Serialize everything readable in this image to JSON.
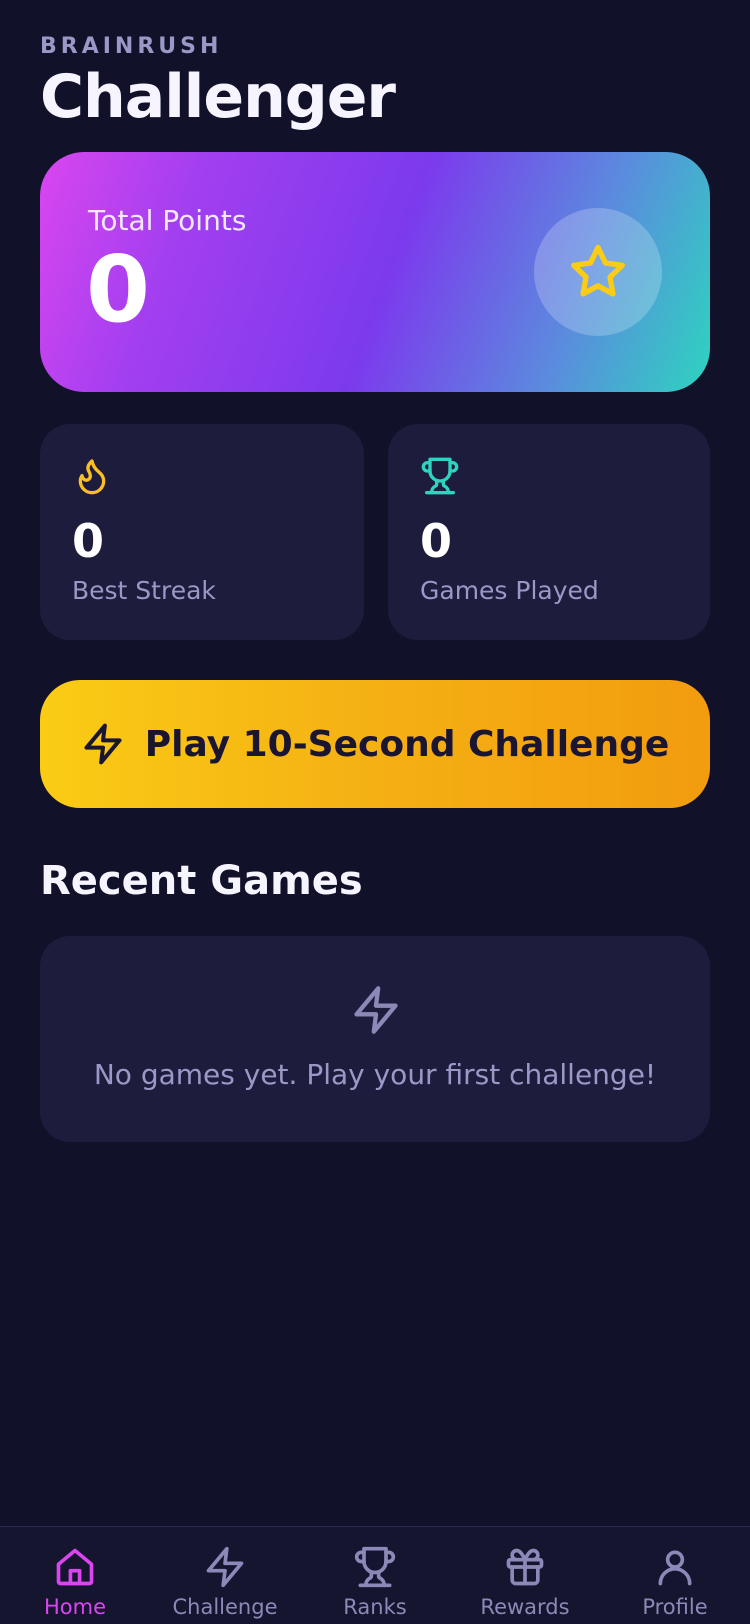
{
  "header": {
    "brand": "BRAINRUSH",
    "title": "Challenger"
  },
  "points_card": {
    "label": "Total Points",
    "value": "0",
    "icon": "star-icon"
  },
  "stats": [
    {
      "value": "0",
      "label": "Best Streak",
      "icon": "flame-icon",
      "color": "#fbbf24"
    },
    {
      "value": "0",
      "label": "Games Played",
      "icon": "trophy-icon",
      "color": "#2dd4bf"
    }
  ],
  "play_button": {
    "label": "Play 10-Second Challenge",
    "icon": "lightning-icon"
  },
  "recent_games": {
    "title": "Recent Games",
    "empty_text": "No games yet. Play your first challenge!",
    "icon": "lightning-icon"
  },
  "bottom_nav": {
    "active": "Home",
    "items": [
      {
        "label": "Home",
        "icon": "home-icon"
      },
      {
        "label": "Challenge",
        "icon": "lightning-icon"
      },
      {
        "label": "Ranks",
        "icon": "trophy-icon"
      },
      {
        "label": "Rewards",
        "icon": "gift-icon"
      },
      {
        "label": "Profile",
        "icon": "user-icon"
      }
    ]
  },
  "colors": {
    "background": "#12112a",
    "card": "#1e1c3c",
    "accent_pink": "#d946ef",
    "accent_yellow": "#facc15",
    "accent_teal": "#2dd4bf",
    "muted_text": "#9b98c7"
  }
}
